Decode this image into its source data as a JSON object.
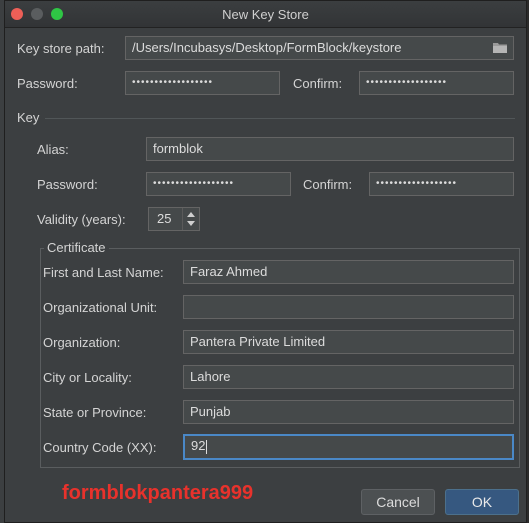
{
  "window": {
    "title": "New Key Store"
  },
  "keystore": {
    "path_label": "Key store path:",
    "path_value": "/Users/Incubasys/Desktop/FormBlock/keystore",
    "password_label": "Password:",
    "password_value": "••••••••••••••••••",
    "confirm_label": "Confirm:",
    "confirm_value": "••••••••••••••••••"
  },
  "key": {
    "section_label": "Key",
    "alias_label": "Alias:",
    "alias_value": "formblok",
    "password_label": "Password:",
    "password_value": "••••••••••••••••••",
    "confirm_label": "Confirm:",
    "confirm_value": "••••••••••••••••••",
    "validity_label": "Validity (years):",
    "validity_value": "25"
  },
  "certificate": {
    "section_label": "Certificate",
    "fields": [
      {
        "label": "First and Last Name:",
        "value": "Faraz Ahmed"
      },
      {
        "label": "Organizational Unit:",
        "value": ""
      },
      {
        "label": "Organization:",
        "value": "Pantera Private Limited"
      },
      {
        "label": "City or Locality:",
        "value": "Lahore"
      },
      {
        "label": "State or Province:",
        "value": "Punjab"
      },
      {
        "label": "Country Code (XX):",
        "value": "92"
      }
    ]
  },
  "overlay_text": "formblokpantera999",
  "buttons": {
    "cancel": "Cancel",
    "ok": "OK"
  },
  "colors": {
    "accent": "#4a88c7",
    "ok_button": "#365880",
    "overlay_red": "#e8322c"
  }
}
